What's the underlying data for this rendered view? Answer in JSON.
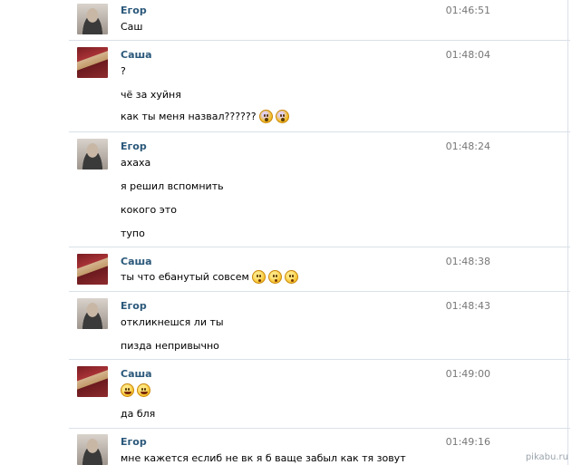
{
  "messages": [
    {
      "author": "Егор",
      "time": "01:46:51",
      "avatar": "egor-avatar",
      "lines": [
        {
          "text": "Саш",
          "emoji": []
        }
      ]
    },
    {
      "author": "Саша",
      "time": "01:48:04",
      "avatar": "sasha-avatar",
      "lines": [
        {
          "text": "?",
          "emoji": []
        },
        {
          "text": "чё за хуйня",
          "emoji": []
        },
        {
          "text": "как ты меня назвал??????",
          "emoji": [
            "scream",
            "scream"
          ]
        }
      ]
    },
    {
      "author": "Егор",
      "time": "01:48:24",
      "avatar": "egor-avatar",
      "lines": [
        {
          "text": "ахаха",
          "emoji": []
        },
        {
          "text": "я решил вспомнить",
          "emoji": []
        },
        {
          "text": "кокого это",
          "emoji": []
        },
        {
          "text": "тупо",
          "emoji": []
        }
      ]
    },
    {
      "author": "Саша",
      "time": "01:48:38",
      "avatar": "sasha-avatar",
      "lines": [
        {
          "text": "ты что ебанутый совсем",
          "emoji": [
            "kiss",
            "kiss",
            "kiss"
          ]
        }
      ]
    },
    {
      "author": "Егор",
      "time": "01:48:43",
      "avatar": "egor-avatar",
      "lines": [
        {
          "text": "откликнешся ли ты",
          "emoji": []
        },
        {
          "text": "пизда непривычно",
          "emoji": []
        }
      ]
    },
    {
      "author": "Саша",
      "time": "01:49:00",
      "avatar": "sasha-avatar",
      "lines": [
        {
          "text": "",
          "emoji": [
            "laugh",
            "laugh"
          ]
        },
        {
          "text": "да бля",
          "emoji": []
        }
      ]
    },
    {
      "author": "Егор",
      "time": "01:49:16",
      "avatar": "egor-avatar",
      "lines": [
        {
          "text": "мне кажется еслиб не вк я б ваще забыл как тя зовут",
          "emoji": []
        }
      ]
    }
  ],
  "watermark": "pikabu.ru"
}
